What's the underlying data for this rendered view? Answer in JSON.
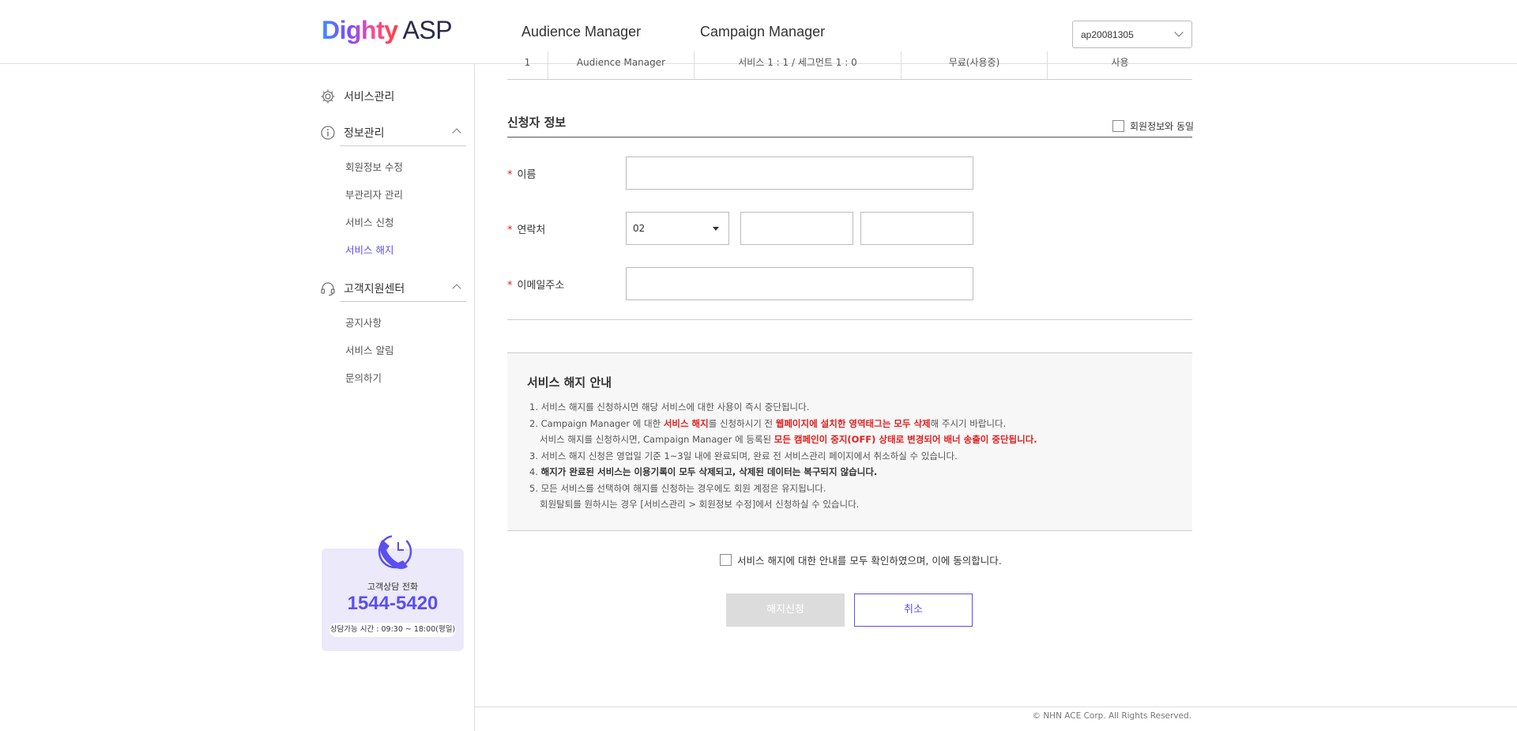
{
  "header": {
    "logo_brand": "Dighty",
    "logo_suffix": "ASP",
    "nav": [
      "Audience Manager",
      "Campaign Manager"
    ],
    "account": "ap20081305"
  },
  "sidebar": {
    "groups": [
      {
        "label": "서비스관리",
        "icon": "gear-icon",
        "items": []
      },
      {
        "label": "정보관리",
        "icon": "info-icon",
        "items": [
          "회원정보 수정",
          "부관리자 관리",
          "서비스 신청",
          "서비스 해지"
        ],
        "active": "서비스 해지"
      },
      {
        "label": "고객지원센터",
        "icon": "headset-icon",
        "items": [
          "공지사항",
          "서비스 알림",
          "문의하기"
        ]
      }
    ],
    "cs": {
      "label": "고객상담 전화",
      "phone": "1544-5420",
      "hours": "상담가능 시간 : 09:30 ~ 18:00(평일)"
    }
  },
  "table_remnant": {
    "cells": [
      "1",
      "Audience Manager",
      "서비스 1 : 1 / 세그먼트 1 : 0",
      "무료(사용중)",
      "사용"
    ]
  },
  "applicant": {
    "title": "신청자 정보",
    "same_as_member": "회원정보와 동일",
    "fields": {
      "name_label": "이름",
      "phone_label": "연락처",
      "phone_prefix": "02",
      "email_label": "이메일주소"
    }
  },
  "notice": {
    "title": "서비스 해지 안내",
    "l1": "1. 서비스 해지를 신청하시면 해당 서비스에 대한 사용이 즉시 중단됩니다.",
    "l2a": "2. Campaign Manager 에 대한 ",
    "l2b": "서비스 해지",
    "l2c": "를 신청하시기 전 ",
    "l2d": "웹페이지에 설치한 영역태그는 모두 삭제",
    "l2e": "해 주시기 바랍니다.",
    "l2f": "서비스 해지를 신청하시면, Campaign Manager 에 등록된 ",
    "l2g": "모든 캠페인이 중지(OFF) 상태로 변경되어 배너 송출이 중단됩니다.",
    "l3": "3. 서비스 해지 신청은 영업일 기준 1~3일 내에 완료되며, 완료 전 서비스관리 페이지에서 취소하실 수 있습니다.",
    "l4a": "4. ",
    "l4b": "해지가 완료된 서비스는 이용기록이 모두 삭제되고, 삭제된 데이터는 복구되지 않습니다.",
    "l5": "5. 모든 서비스를 선택하여 해지를 신청하는 경우에도 회원 계정은 유지됩니다.",
    "l5b": "회원탈퇴를 원하시는 경우 [서비스관리 > 회원정보 수정]에서 신청하실 수 있습니다."
  },
  "agree_text": "서비스 해지에 대한 안내를 모두 확인하였으며, 이에 동의합니다.",
  "buttons": {
    "apply": "해지신청",
    "cancel": "취소"
  },
  "footer": {
    "copyright": "© NHN ACE Corp. All Rights Reserved."
  },
  "colors": {
    "accent": "#5a4ff0",
    "danger": "#e02020",
    "cs_bg": "#ece9fb"
  }
}
